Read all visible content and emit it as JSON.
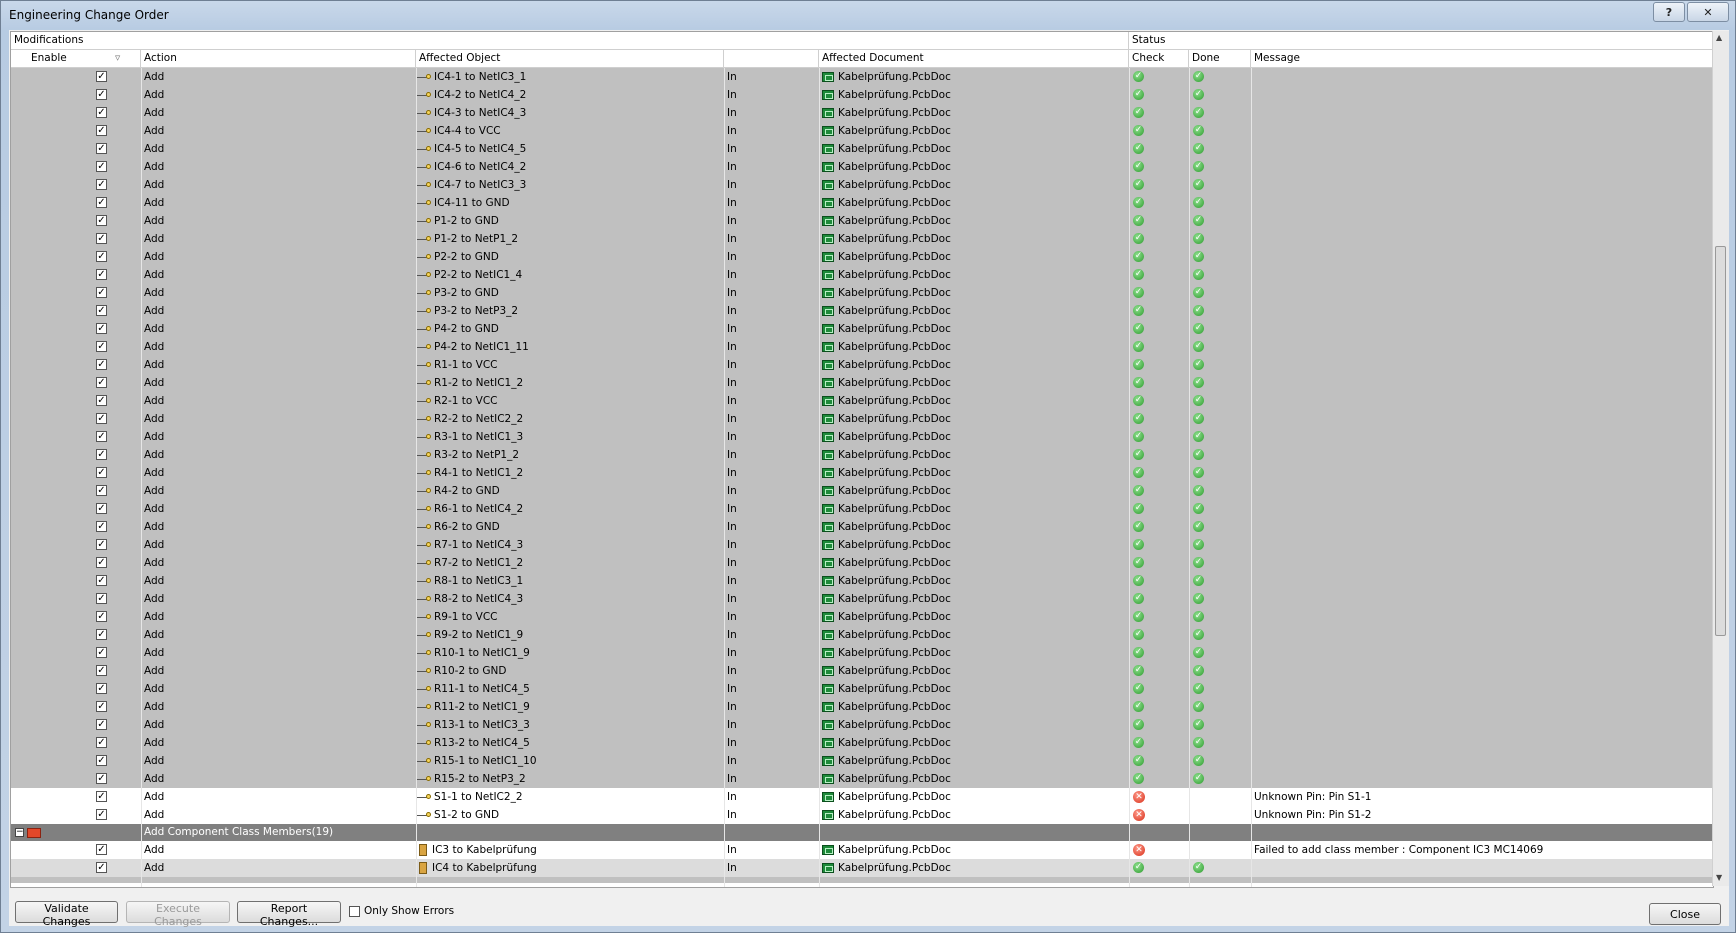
{
  "window": {
    "title": "Engineering Change Order",
    "help_label": "?",
    "close_label": "✕"
  },
  "headers": {
    "group_modifications": "Modifications",
    "group_status": "Status",
    "enable": "Enable",
    "action": "Action",
    "affected_object": "Affected Object",
    "direction": "",
    "affected_document": "Affected Document",
    "check": "Check",
    "done": "Done",
    "message": "Message"
  },
  "rows": [
    {
      "action": "Add",
      "object": "IC4-1 to NetIC3_1",
      "dir": "In",
      "doc": "Kabelprüfung.PcbDoc",
      "check": "ok",
      "done": "ok",
      "message": ""
    },
    {
      "action": "Add",
      "object": "IC4-2 to NetIC4_2",
      "dir": "In",
      "doc": "Kabelprüfung.PcbDoc",
      "check": "ok",
      "done": "ok",
      "message": ""
    },
    {
      "action": "Add",
      "object": "IC4-3 to NetIC4_3",
      "dir": "In",
      "doc": "Kabelprüfung.PcbDoc",
      "check": "ok",
      "done": "ok",
      "message": ""
    },
    {
      "action": "Add",
      "object": "IC4-4 to VCC",
      "dir": "In",
      "doc": "Kabelprüfung.PcbDoc",
      "check": "ok",
      "done": "ok",
      "message": ""
    },
    {
      "action": "Add",
      "object": "IC4-5 to NetIC4_5",
      "dir": "In",
      "doc": "Kabelprüfung.PcbDoc",
      "check": "ok",
      "done": "ok",
      "message": ""
    },
    {
      "action": "Add",
      "object": "IC4-6 to NetIC4_2",
      "dir": "In",
      "doc": "Kabelprüfung.PcbDoc",
      "check": "ok",
      "done": "ok",
      "message": ""
    },
    {
      "action": "Add",
      "object": "IC4-7 to NetIC3_3",
      "dir": "In",
      "doc": "Kabelprüfung.PcbDoc",
      "check": "ok",
      "done": "ok",
      "message": ""
    },
    {
      "action": "Add",
      "object": "IC4-11 to GND",
      "dir": "In",
      "doc": "Kabelprüfung.PcbDoc",
      "check": "ok",
      "done": "ok",
      "message": ""
    },
    {
      "action": "Add",
      "object": "P1-2 to GND",
      "dir": "In",
      "doc": "Kabelprüfung.PcbDoc",
      "check": "ok",
      "done": "ok",
      "message": ""
    },
    {
      "action": "Add",
      "object": "P1-2 to NetP1_2",
      "dir": "In",
      "doc": "Kabelprüfung.PcbDoc",
      "check": "ok",
      "done": "ok",
      "message": ""
    },
    {
      "action": "Add",
      "object": "P2-2 to GND",
      "dir": "In",
      "doc": "Kabelprüfung.PcbDoc",
      "check": "ok",
      "done": "ok",
      "message": ""
    },
    {
      "action": "Add",
      "object": "P2-2 to NetIC1_4",
      "dir": "In",
      "doc": "Kabelprüfung.PcbDoc",
      "check": "ok",
      "done": "ok",
      "message": ""
    },
    {
      "action": "Add",
      "object": "P3-2 to GND",
      "dir": "In",
      "doc": "Kabelprüfung.PcbDoc",
      "check": "ok",
      "done": "ok",
      "message": ""
    },
    {
      "action": "Add",
      "object": "P3-2 to NetP3_2",
      "dir": "In",
      "doc": "Kabelprüfung.PcbDoc",
      "check": "ok",
      "done": "ok",
      "message": ""
    },
    {
      "action": "Add",
      "object": "P4-2 to GND",
      "dir": "In",
      "doc": "Kabelprüfung.PcbDoc",
      "check": "ok",
      "done": "ok",
      "message": ""
    },
    {
      "action": "Add",
      "object": "P4-2 to NetIC1_11",
      "dir": "In",
      "doc": "Kabelprüfung.PcbDoc",
      "check": "ok",
      "done": "ok",
      "message": ""
    },
    {
      "action": "Add",
      "object": "R1-1 to VCC",
      "dir": "In",
      "doc": "Kabelprüfung.PcbDoc",
      "check": "ok",
      "done": "ok",
      "message": ""
    },
    {
      "action": "Add",
      "object": "R1-2 to NetIC1_2",
      "dir": "In",
      "doc": "Kabelprüfung.PcbDoc",
      "check": "ok",
      "done": "ok",
      "message": ""
    },
    {
      "action": "Add",
      "object": "R2-1 to VCC",
      "dir": "In",
      "doc": "Kabelprüfung.PcbDoc",
      "check": "ok",
      "done": "ok",
      "message": ""
    },
    {
      "action": "Add",
      "object": "R2-2 to NetIC2_2",
      "dir": "In",
      "doc": "Kabelprüfung.PcbDoc",
      "check": "ok",
      "done": "ok",
      "message": ""
    },
    {
      "action": "Add",
      "object": "R3-1 to NetIC1_3",
      "dir": "In",
      "doc": "Kabelprüfung.PcbDoc",
      "check": "ok",
      "done": "ok",
      "message": ""
    },
    {
      "action": "Add",
      "object": "R3-2 to NetP1_2",
      "dir": "In",
      "doc": "Kabelprüfung.PcbDoc",
      "check": "ok",
      "done": "ok",
      "message": ""
    },
    {
      "action": "Add",
      "object": "R4-1 to NetIC1_2",
      "dir": "In",
      "doc": "Kabelprüfung.PcbDoc",
      "check": "ok",
      "done": "ok",
      "message": ""
    },
    {
      "action": "Add",
      "object": "R4-2 to GND",
      "dir": "In",
      "doc": "Kabelprüfung.PcbDoc",
      "check": "ok",
      "done": "ok",
      "message": ""
    },
    {
      "action": "Add",
      "object": "R6-1 to NetIC4_2",
      "dir": "In",
      "doc": "Kabelprüfung.PcbDoc",
      "check": "ok",
      "done": "ok",
      "message": ""
    },
    {
      "action": "Add",
      "object": "R6-2 to GND",
      "dir": "In",
      "doc": "Kabelprüfung.PcbDoc",
      "check": "ok",
      "done": "ok",
      "message": ""
    },
    {
      "action": "Add",
      "object": "R7-1 to NetIC4_3",
      "dir": "In",
      "doc": "Kabelprüfung.PcbDoc",
      "check": "ok",
      "done": "ok",
      "message": ""
    },
    {
      "action": "Add",
      "object": "R7-2 to NetIC1_2",
      "dir": "In",
      "doc": "Kabelprüfung.PcbDoc",
      "check": "ok",
      "done": "ok",
      "message": ""
    },
    {
      "action": "Add",
      "object": "R8-1 to NetIC3_1",
      "dir": "In",
      "doc": "Kabelprüfung.PcbDoc",
      "check": "ok",
      "done": "ok",
      "message": ""
    },
    {
      "action": "Add",
      "object": "R8-2 to NetIC4_3",
      "dir": "In",
      "doc": "Kabelprüfung.PcbDoc",
      "check": "ok",
      "done": "ok",
      "message": ""
    },
    {
      "action": "Add",
      "object": "R9-1 to VCC",
      "dir": "In",
      "doc": "Kabelprüfung.PcbDoc",
      "check": "ok",
      "done": "ok",
      "message": ""
    },
    {
      "action": "Add",
      "object": "R9-2 to NetIC1_9",
      "dir": "In",
      "doc": "Kabelprüfung.PcbDoc",
      "check": "ok",
      "done": "ok",
      "message": ""
    },
    {
      "action": "Add",
      "object": "R10-1 to NetIC1_9",
      "dir": "In",
      "doc": "Kabelprüfung.PcbDoc",
      "check": "ok",
      "done": "ok",
      "message": ""
    },
    {
      "action": "Add",
      "object": "R10-2 to GND",
      "dir": "In",
      "doc": "Kabelprüfung.PcbDoc",
      "check": "ok",
      "done": "ok",
      "message": ""
    },
    {
      "action": "Add",
      "object": "R11-1 to NetIC4_5",
      "dir": "In",
      "doc": "Kabelprüfung.PcbDoc",
      "check": "ok",
      "done": "ok",
      "message": ""
    },
    {
      "action": "Add",
      "object": "R11-2 to NetIC1_9",
      "dir": "In",
      "doc": "Kabelprüfung.PcbDoc",
      "check": "ok",
      "done": "ok",
      "message": ""
    },
    {
      "action": "Add",
      "object": "R13-1 to NetIC3_3",
      "dir": "In",
      "doc": "Kabelprüfung.PcbDoc",
      "check": "ok",
      "done": "ok",
      "message": ""
    },
    {
      "action": "Add",
      "object": "R13-2 to NetIC4_5",
      "dir": "In",
      "doc": "Kabelprüfung.PcbDoc",
      "check": "ok",
      "done": "ok",
      "message": ""
    },
    {
      "action": "Add",
      "object": "R15-1 to NetIC1_10",
      "dir": "In",
      "doc": "Kabelprüfung.PcbDoc",
      "check": "ok",
      "done": "ok",
      "message": ""
    },
    {
      "action": "Add",
      "object": "R15-2 to NetP3_2",
      "dir": "In",
      "doc": "Kabelprüfung.PcbDoc",
      "check": "ok",
      "done": "ok",
      "message": ""
    },
    {
      "action": "Add",
      "object": "S1-1 to NetIC2_2",
      "dir": "In",
      "doc": "Kabelprüfung.PcbDoc",
      "check": "error",
      "done": "",
      "message": "Unknown Pin: Pin S1-1"
    },
    {
      "action": "Add",
      "object": "S1-2 to GND",
      "dir": "In",
      "doc": "Kabelprüfung.PcbDoc",
      "check": "error",
      "done": "",
      "message": "Unknown Pin: Pin S1-2"
    }
  ],
  "group": {
    "expand_label": "−",
    "label": "Add Component Class Members(19)"
  },
  "group_rows": [
    {
      "action": "Add",
      "object": "IC3 to Kabelprüfung",
      "dir": "In",
      "doc": "Kabelprüfung.PcbDoc",
      "check": "error",
      "done": "",
      "message": "Failed to add class member : Component IC3 MC14069"
    },
    {
      "action": "Add",
      "object": "IC4 to Kabelprüfung",
      "dir": "In",
      "doc": "Kabelprüfung.PcbDoc",
      "check": "ok",
      "done": "ok",
      "message": ""
    }
  ],
  "buttons": {
    "validate": "Validate Changes",
    "execute": "Execute Changes",
    "report": "Report Changes...",
    "only_errors": "Only Show Errors",
    "close": "Close"
  },
  "glyphs": {
    "check": "✓",
    "cross": "✕",
    "up": "▲",
    "down": "▼"
  }
}
